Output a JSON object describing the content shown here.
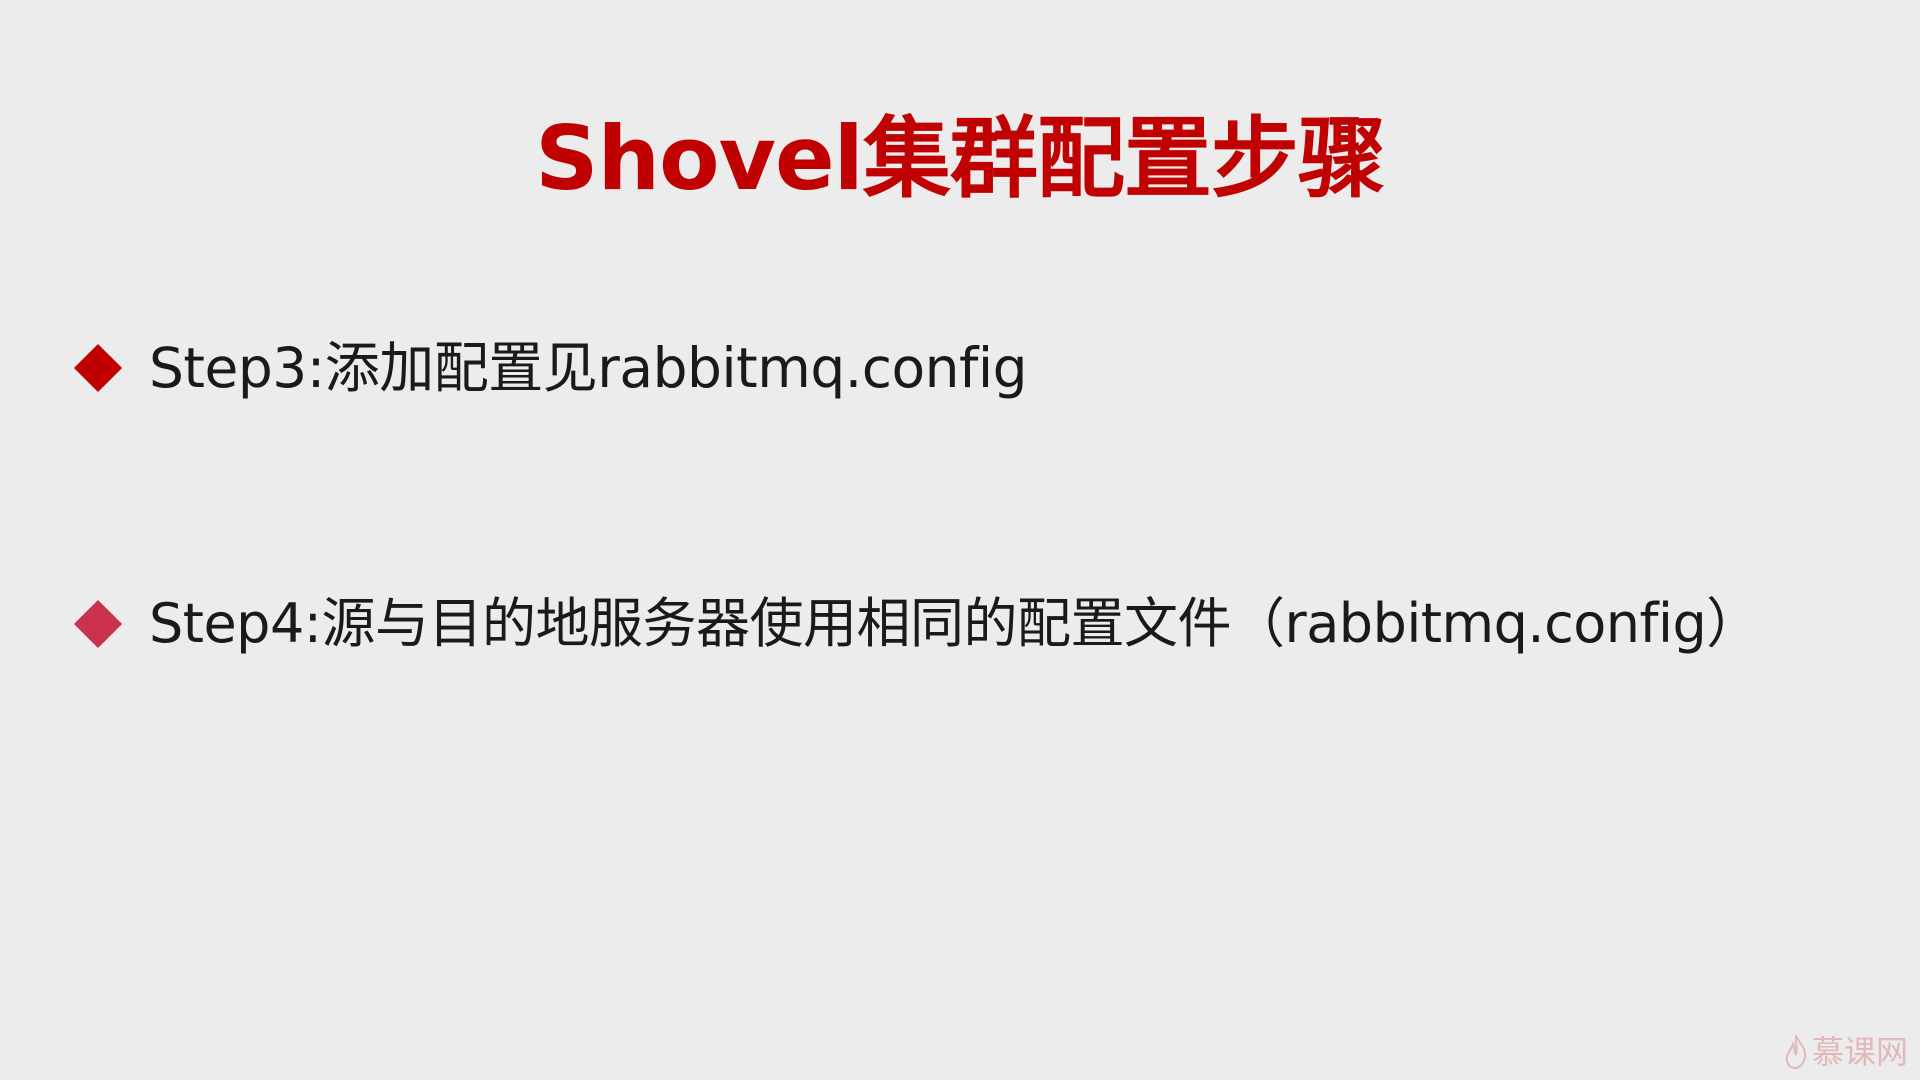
{
  "slide": {
    "title": "Shovel集群配置步骤",
    "bullets": [
      {
        "text": "Step3:添加配置见rabbitmq.config",
        "icon": "diamond-bullet-icon",
        "color": "#c00000"
      },
      {
        "text": "Step4:源与目的地服务器使用相同的配置文件（rabbitmq.config）",
        "icon": "diamond-bullet-icon",
        "color": "#c8324a"
      }
    ]
  },
  "watermark": {
    "icon": "flame-logo-icon",
    "text": "慕课网"
  },
  "colors": {
    "title": "#c00000",
    "background": "#ececec",
    "body_text": "#1a1a1a"
  }
}
